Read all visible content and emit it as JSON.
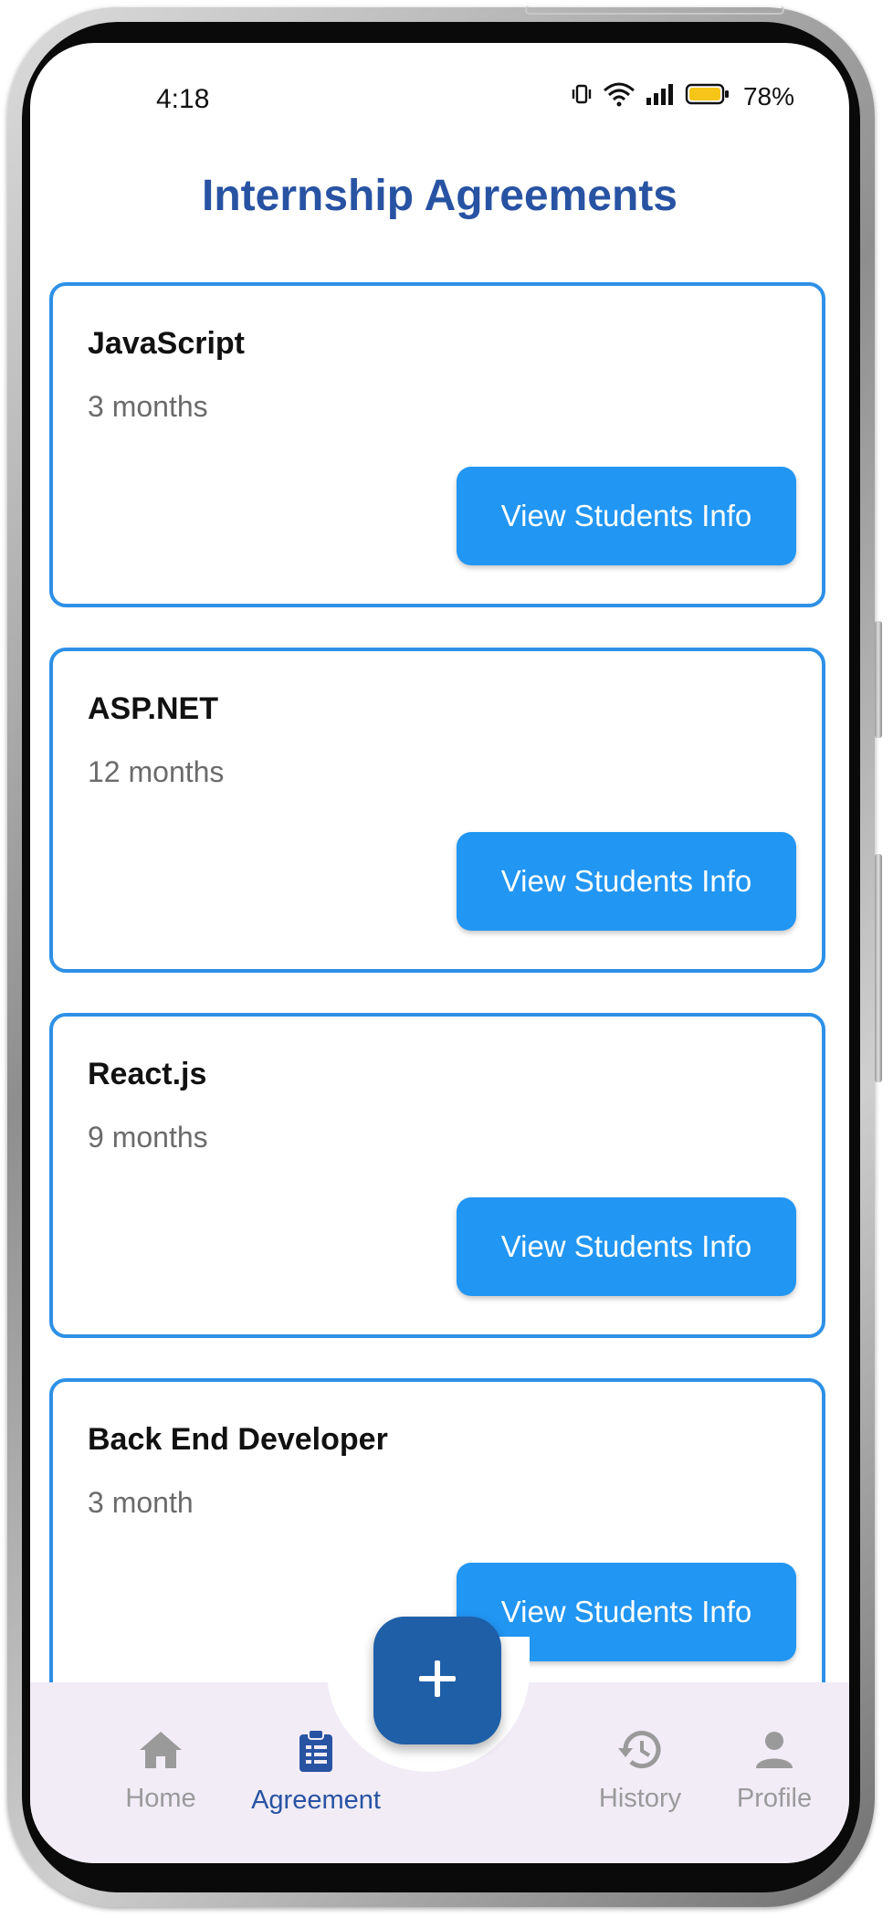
{
  "status_bar": {
    "time": "4:18",
    "battery_percent": "78%",
    "icons": [
      "vibrate-icon",
      "wifi-icon",
      "signal-icon",
      "battery-icon"
    ]
  },
  "page": {
    "title": "Internship Agreements"
  },
  "agreements": [
    {
      "title": "JavaScript",
      "duration": "3 months",
      "button_label": "View Students Info"
    },
    {
      "title": "ASP.NET",
      "duration": "12 months",
      "button_label": "View Students Info"
    },
    {
      "title": "React.js",
      "duration": "9 months",
      "button_label": "View Students Info"
    },
    {
      "title": "Back End Developer",
      "duration": "3 month",
      "button_label": "View Students Info"
    }
  ],
  "fab": {
    "icon": "plus-icon"
  },
  "bottom_nav": {
    "active": "Agreement",
    "items": [
      {
        "label": "Home",
        "icon": "home-icon"
      },
      {
        "label": "Agreement",
        "icon": "clipboard-icon"
      },
      {
        "label": "History",
        "icon": "history-icon"
      },
      {
        "label": "Profile",
        "icon": "person-icon"
      }
    ]
  },
  "colors": {
    "title": "#2853a3",
    "card_border": "#2e90e6",
    "button": "#2196f3",
    "fab": "#1f5fa8",
    "nav_background": "#f1ecf6",
    "nav_active": "#2853a3",
    "nav_inactive": "#9a9a9a",
    "battery_fill": "#f5c518"
  }
}
